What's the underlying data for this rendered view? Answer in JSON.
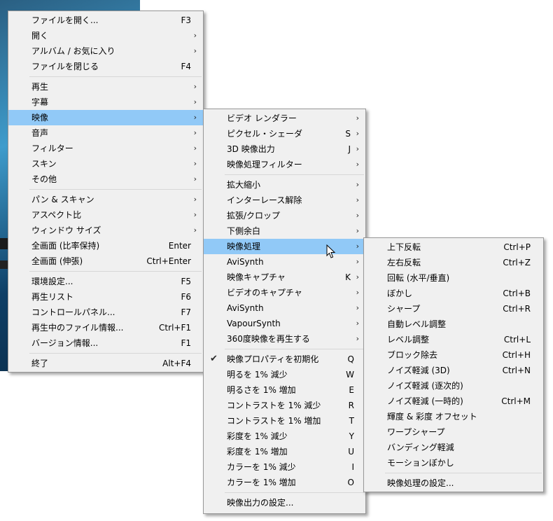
{
  "main_menu": {
    "groups": [
      [
        {
          "label": "ファイルを開く...",
          "shortcut": "F3"
        },
        {
          "label": "開く",
          "arrow": true
        },
        {
          "label": "アルバム / お気に入り",
          "arrow": true
        },
        {
          "label": "ファイルを閉じる",
          "shortcut": "F4"
        }
      ],
      [
        {
          "label": "再生",
          "arrow": true
        },
        {
          "label": "字幕",
          "arrow": true
        },
        {
          "label": "映像",
          "arrow": true,
          "highlighted": true
        },
        {
          "label": "音声",
          "arrow": true
        },
        {
          "label": "フィルター",
          "arrow": true
        },
        {
          "label": "スキン",
          "arrow": true
        },
        {
          "label": "その他",
          "arrow": true
        }
      ],
      [
        {
          "label": "パン & スキャン",
          "arrow": true
        },
        {
          "label": "アスペクト比",
          "arrow": true
        },
        {
          "label": "ウィンドウ サイズ",
          "arrow": true
        },
        {
          "label": "全画面 (比率保持)",
          "shortcut": "Enter"
        },
        {
          "label": "全画面 (伸張)",
          "shortcut": "Ctrl+Enter"
        }
      ],
      [
        {
          "label": "環境設定...",
          "shortcut": "F5"
        },
        {
          "label": "再生リスト",
          "shortcut": "F6"
        },
        {
          "label": "コントロールパネル...",
          "shortcut": "F7"
        },
        {
          "label": "再生中のファイル情報...",
          "shortcut": "Ctrl+F1"
        },
        {
          "label": "バージョン情報...",
          "shortcut": "F1"
        }
      ],
      [
        {
          "label": "終了",
          "shortcut": "Alt+F4"
        }
      ]
    ]
  },
  "video_menu": {
    "groups": [
      [
        {
          "label": "ビデオ レンダラー",
          "arrow": true
        },
        {
          "label": "ピクセル・シェーダ",
          "shortcut": "S",
          "arrow": true
        },
        {
          "label": "3D 映像出力",
          "shortcut": "J",
          "arrow": true
        },
        {
          "label": "映像処理フィルター",
          "arrow": true
        }
      ],
      [
        {
          "label": "拡大縮小",
          "arrow": true
        },
        {
          "label": "インターレース解除",
          "arrow": true
        },
        {
          "label": "拡張/クロップ",
          "arrow": true
        },
        {
          "label": "下側余白",
          "arrow": true
        },
        {
          "label": "映像処理",
          "arrow": true,
          "highlighted": true
        },
        {
          "label": "AviSynth",
          "arrow": true
        },
        {
          "label": "映像キャプチャ",
          "shortcut": "K",
          "arrow": true
        },
        {
          "label": "ビデオのキャプチャ",
          "arrow": true
        },
        {
          "label": "AviSynth",
          "arrow": true
        },
        {
          "label": "VapourSynth",
          "arrow": true
        },
        {
          "label": "360度映像を再生する",
          "arrow": true
        }
      ],
      [
        {
          "label": "映像プロパティを初期化",
          "shortcut": "Q",
          "checked": true
        },
        {
          "label": "明るを 1% 減少",
          "shortcut": "W"
        },
        {
          "label": "明るさを 1% 増加",
          "shortcut": "E"
        },
        {
          "label": "コントラストを 1% 減少",
          "shortcut": "R"
        },
        {
          "label": "コントラストを 1% 増加",
          "shortcut": "T"
        },
        {
          "label": "彩度を 1% 減少",
          "shortcut": "Y"
        },
        {
          "label": "彩度を 1% 増加",
          "shortcut": "U"
        },
        {
          "label": "カラーを 1% 減少",
          "shortcut": "I"
        },
        {
          "label": "カラーを 1% 増加",
          "shortcut": "O"
        }
      ],
      [
        {
          "label": "映像出力の設定..."
        }
      ]
    ]
  },
  "processing_menu": {
    "groups": [
      [
        {
          "label": "上下反転",
          "shortcut": "Ctrl+P"
        },
        {
          "label": "左右反転",
          "shortcut": "Ctrl+Z"
        },
        {
          "label": "回転 (水平/垂直)"
        },
        {
          "label": "ぼかし",
          "shortcut": "Ctrl+B"
        },
        {
          "label": "シャープ",
          "shortcut": "Ctrl+R"
        },
        {
          "label": "自動レベル調整"
        },
        {
          "label": "レベル調整",
          "shortcut": "Ctrl+L"
        },
        {
          "label": "ブロック除去",
          "shortcut": "Ctrl+H"
        },
        {
          "label": "ノイズ軽減 (3D)",
          "shortcut": "Ctrl+N"
        },
        {
          "label": "ノイズ軽減 (逐次的)"
        },
        {
          "label": "ノイズ軽減 (一時的)",
          "shortcut": "Ctrl+M"
        },
        {
          "label": "輝度 & 彩度 オフセット"
        },
        {
          "label": "ワープシャープ"
        },
        {
          "label": "バンディング軽減"
        },
        {
          "label": "モーションぼかし"
        }
      ],
      [
        {
          "label": "映像処理の設定..."
        }
      ]
    ]
  },
  "icons": {
    "submenu_arrow": "›",
    "check": "✔"
  }
}
